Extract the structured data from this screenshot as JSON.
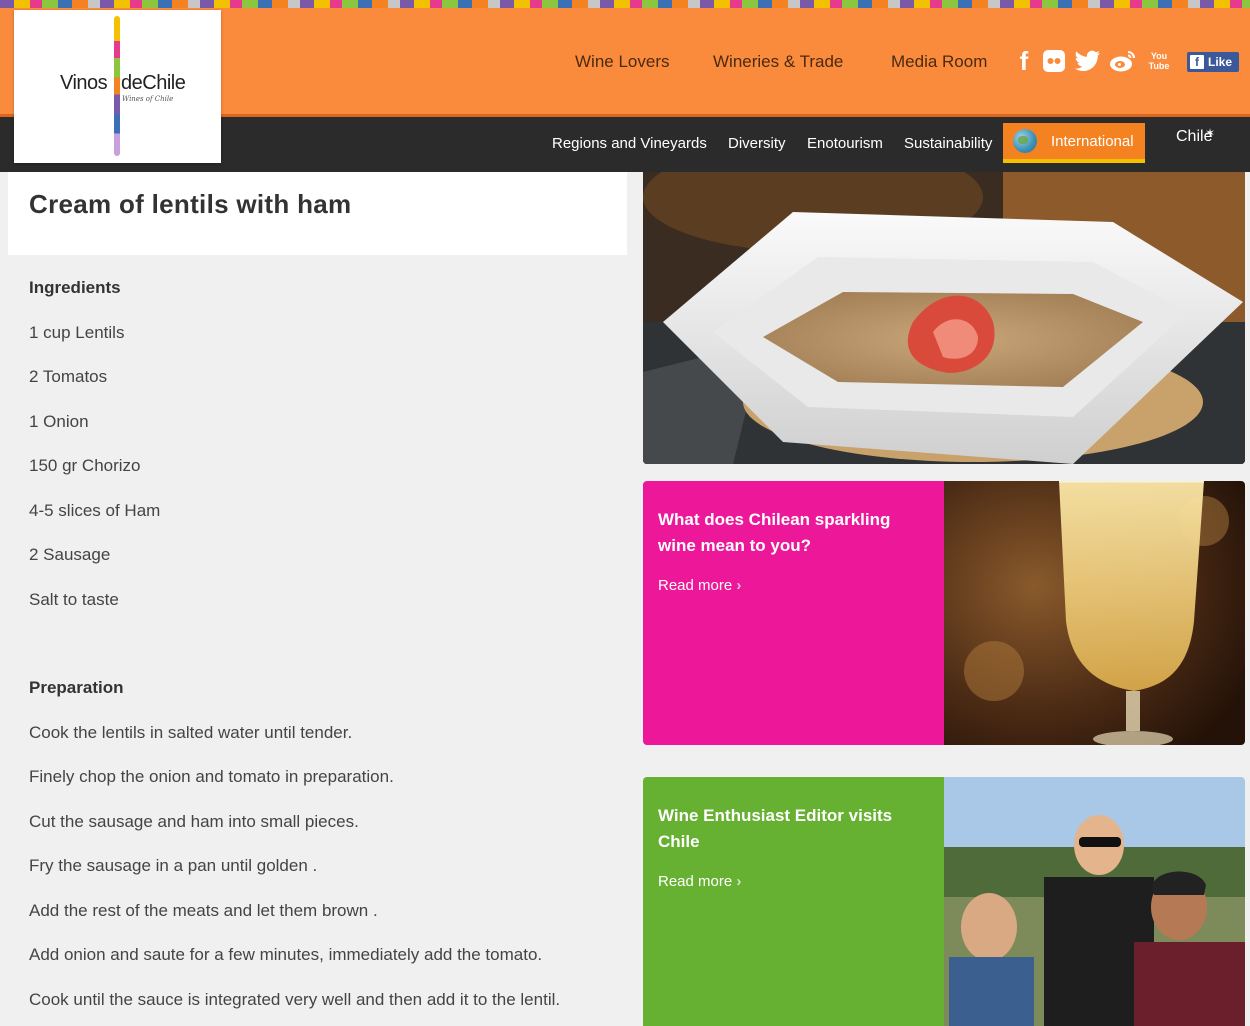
{
  "brand": {
    "name_left": "Vinos",
    "name_right": "deChile",
    "tagline": "Wines of Chile",
    "colors": {
      "orange": "#fb8b3c",
      "dark": "#2b2b2b",
      "magenta": "#ec1899",
      "green": "#66b032"
    }
  },
  "top_nav": {
    "items": [
      "Wine Lovers",
      "Wineries & Trade",
      "Media Room"
    ],
    "social_icons": [
      "facebook-icon",
      "flickr-icon",
      "twitter-icon",
      "weibo-icon",
      "youtube-icon"
    ],
    "youtube_label": "You Tube",
    "fb_like": "Like"
  },
  "main_nav": {
    "items": [
      "Regions and Vineyards",
      "Diversity",
      "Enotourism",
      "Sustainability"
    ],
    "international": "International",
    "chile_mark": "Chile"
  },
  "recipe": {
    "title": "Cream of lentils with ham",
    "ingredients_heading": "Ingredients",
    "ingredients": [
      "1 cup Lentils",
      "2 Tomatos",
      "1 Onion",
      "150 gr Chorizo",
      "4-5 slices of Ham",
      "2 Sausage",
      "Salt to taste"
    ],
    "preparation_heading": "Preparation",
    "steps": [
      "Cook the lentils in salted water until tender.",
      "Finely chop the onion and tomato in preparation.",
      "Cut the sausage and ham into small pieces.",
      "Fry the sausage in a pan until golden .",
      "Add the rest of the meats and let them brown .",
      "Add onion and saute for a few minutes, immediately add the tomato.",
      "Cook until the sauce is integrated very well and then add it to the lentil."
    ]
  },
  "promos": [
    {
      "title": "What does Chilean sparkling wine mean to you?",
      "link": "Read more"
    },
    {
      "title": "Wine Enthusiast Editor visits Chile",
      "link": "Read more"
    }
  ]
}
